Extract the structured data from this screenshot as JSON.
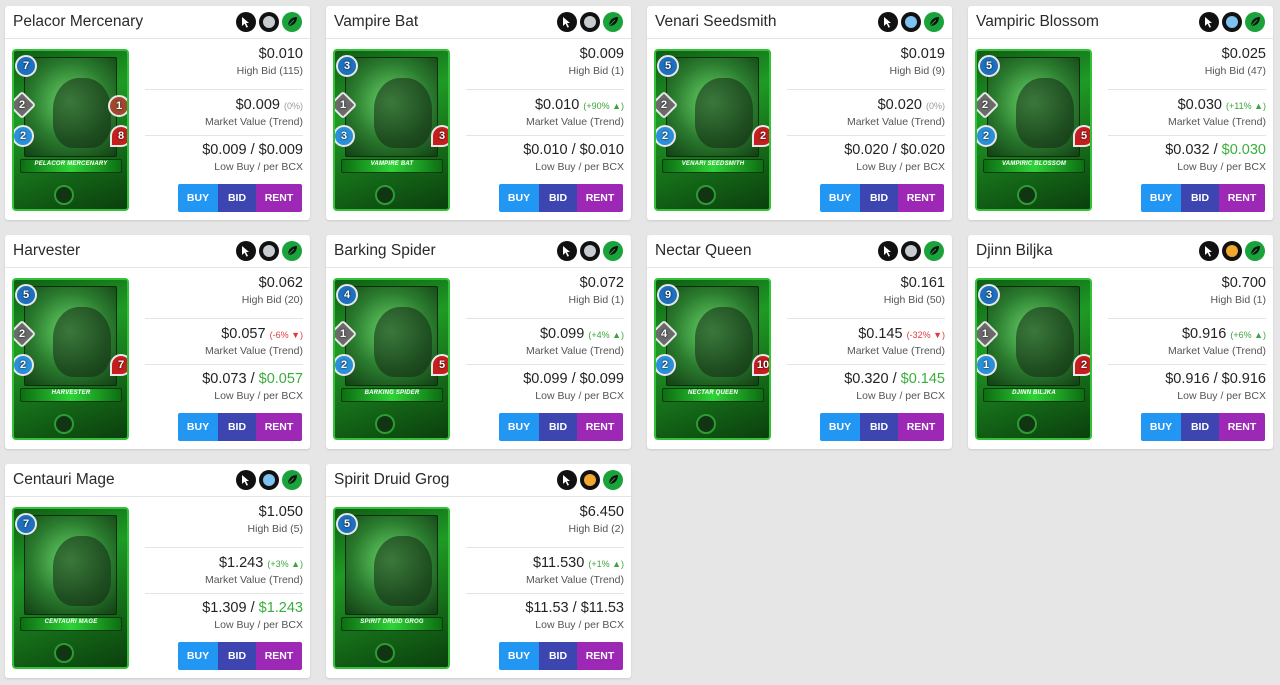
{
  "colors": {
    "buy": "#2196f3",
    "bid": "#3d46b0",
    "rent": "#9d28b5",
    "trend_up": "#3ea43f",
    "trend_down": "#e03b3b",
    "card_frame_green": "#33c13a"
  },
  "icons": {
    "foil": "sword-cursor-icon",
    "edition": "orb-icon",
    "element": "leaf-icon"
  },
  "labels": {
    "high_bid_prefix": "High Bid",
    "market_value": "Market Value (Trend)",
    "low_buy": "Low Buy / per BCX",
    "buy": "BUY",
    "bid": "BID",
    "rent": "RENT"
  },
  "cards": [
    {
      "name": "Pelacor Mercenary",
      "art_name": "PELACOR MERCENARY",
      "orb_color": "#c8ccd0",
      "high_bid": "$0.010",
      "high_bid_label": "High Bid (115)",
      "market": "$0.009",
      "trend": "(0%)",
      "trend_dir": "flat",
      "low_buy": "$0.009",
      "per_bcx": "$0.009",
      "per_bcx_green": false,
      "stats": {
        "mana": "7",
        "atk": "2",
        "spd": "2",
        "armor": "1",
        "hp": "8"
      }
    },
    {
      "name": "Vampire Bat",
      "art_name": "VAMPIRE BAT",
      "orb_color": "#c8ccd0",
      "high_bid": "$0.009",
      "high_bid_label": "High Bid (1)",
      "market": "$0.010",
      "trend": "(+90% ▲)",
      "trend_dir": "up",
      "low_buy": "$0.010",
      "per_bcx": "$0.010",
      "per_bcx_green": false,
      "stats": {
        "mana": "3",
        "atk": "1",
        "spd": "3",
        "armor": "",
        "hp": "3"
      }
    },
    {
      "name": "Venari Seedsmith",
      "art_name": "VENARI SEEDSMITH",
      "orb_color": "#7fc1f0",
      "high_bid": "$0.019",
      "high_bid_label": "High Bid (9)",
      "market": "$0.020",
      "trend": "(0%)",
      "trend_dir": "flat",
      "low_buy": "$0.020",
      "per_bcx": "$0.020",
      "per_bcx_green": false,
      "stats": {
        "mana": "5",
        "atk": "2",
        "spd": "2",
        "armor": "",
        "hp": "2"
      }
    },
    {
      "name": "Vampiric Blossom",
      "art_name": "VAMPIRIC BLOSSOM",
      "orb_color": "#7fc1f0",
      "high_bid": "$0.025",
      "high_bid_label": "High Bid (47)",
      "market": "$0.030",
      "trend": "(+11% ▲)",
      "trend_dir": "up",
      "low_buy": "$0.032",
      "per_bcx": "$0.030",
      "per_bcx_green": true,
      "stats": {
        "mana": "5",
        "atk": "2",
        "spd": "2",
        "armor": "",
        "hp": "5"
      }
    },
    {
      "name": "Harvester",
      "art_name": "HARVESTER",
      "orb_color": "#c8ccd0",
      "high_bid": "$0.062",
      "high_bid_label": "High Bid (20)",
      "market": "$0.057",
      "trend": "(-6% ▼)",
      "trend_dir": "down",
      "low_buy": "$0.073",
      "per_bcx": "$0.057",
      "per_bcx_green": true,
      "stats": {
        "mana": "5",
        "atk": "2",
        "spd": "2",
        "armor": "",
        "hp": "7"
      }
    },
    {
      "name": "Barking Spider",
      "art_name": "BARKING SPIDER",
      "orb_color": "#c8ccd0",
      "high_bid": "$0.072",
      "high_bid_label": "High Bid (1)",
      "market": "$0.099",
      "trend": "(+4% ▲)",
      "trend_dir": "up",
      "low_buy": "$0.099",
      "per_bcx": "$0.099",
      "per_bcx_green": false,
      "stats": {
        "mana": "4",
        "atk": "1",
        "spd": "2",
        "armor": "",
        "hp": "5"
      }
    },
    {
      "name": "Nectar Queen",
      "art_name": "NECTAR QUEEN",
      "orb_color": "#c8ccd0",
      "high_bid": "$0.161",
      "high_bid_label": "High Bid (50)",
      "market": "$0.145",
      "trend": "(-32% ▼)",
      "trend_dir": "down",
      "low_buy": "$0.320",
      "per_bcx": "$0.145",
      "per_bcx_green": true,
      "stats": {
        "mana": "9",
        "atk": "4",
        "spd": "2",
        "armor": "",
        "hp": "10"
      }
    },
    {
      "name": "Djinn Biljka",
      "art_name": "DJINN BILJKA",
      "orb_color": "#f0a830",
      "high_bid": "$0.700",
      "high_bid_label": "High Bid (1)",
      "market": "$0.916",
      "trend": "(+6% ▲)",
      "trend_dir": "up",
      "low_buy": "$0.916",
      "per_bcx": "$0.916",
      "per_bcx_green": false,
      "stats": {
        "mana": "3",
        "atk": "1",
        "spd": "1",
        "armor": "",
        "hp": "2"
      }
    },
    {
      "name": "Centauri Mage",
      "art_name": "CENTAURI MAGE",
      "orb_color": "#7fc1f0",
      "high_bid": "$1.050",
      "high_bid_label": "High Bid (5)",
      "market": "$1.243",
      "trend": "(+3% ▲)",
      "trend_dir": "up",
      "low_buy": "$1.309",
      "per_bcx": "$1.243",
      "per_bcx_green": true,
      "stats": {
        "mana": "7",
        "atk": "",
        "spd": "",
        "armor": "",
        "hp": ""
      }
    },
    {
      "name": "Spirit Druid Grog",
      "art_name": "SPIRIT DRUID GROG",
      "orb_color": "#f0a830",
      "high_bid": "$6.450",
      "high_bid_label": "High Bid (2)",
      "market": "$11.530",
      "trend": "(+1% ▲)",
      "trend_dir": "up",
      "low_buy": "$11.53",
      "per_bcx": "$11.53",
      "per_bcx_green": false,
      "stats": {
        "mana": "5",
        "atk": "",
        "spd": "",
        "armor": "",
        "hp": ""
      }
    }
  ]
}
